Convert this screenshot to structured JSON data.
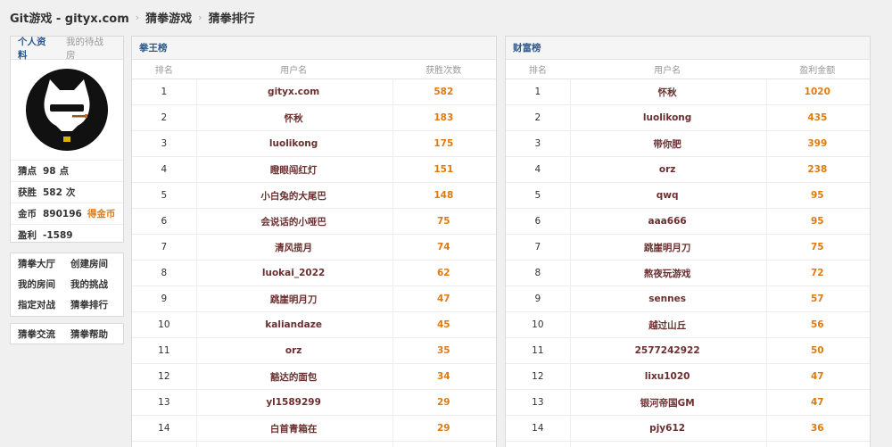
{
  "breadcrumb": [
    "Git游戏 - gityx.com",
    "猜拳游戏",
    "猜拳排行"
  ],
  "profile": {
    "tab_active": "个人资料",
    "tab_inactive": "我的待战房",
    "stats": [
      {
        "key": "猜点",
        "value": "98",
        "unit": "点"
      },
      {
        "key": "获胜",
        "value": "582",
        "unit": "次"
      },
      {
        "key": "金币",
        "value": "890196",
        "extra": "得金币"
      },
      {
        "key": "盈利",
        "value": "-1589"
      }
    ]
  },
  "menu1": [
    [
      "猜拳大厅",
      "创建房间"
    ],
    [
      "我的房间",
      "我的挑战"
    ],
    [
      "指定对战",
      "猜拳排行"
    ]
  ],
  "menu2": [
    "猜拳交流",
    "猜拳帮助"
  ],
  "left_board": {
    "title": "拳王榜",
    "headers": [
      "排名",
      "用户名",
      "获胜次数"
    ],
    "rows": [
      [
        "1",
        "gityx.com",
        "582"
      ],
      [
        "2",
        "怀秋",
        "183"
      ],
      [
        "3",
        "luolikong",
        "175"
      ],
      [
        "4",
        "瞪眼闯红灯",
        "151"
      ],
      [
        "5",
        "小白兔的大尾巴",
        "148"
      ],
      [
        "6",
        "会说话的小哑巴",
        "75"
      ],
      [
        "7",
        "清风揽月",
        "74"
      ],
      [
        "8",
        "luokai_2022",
        "62"
      ],
      [
        "9",
        "跳崖明月刀",
        "47"
      ],
      [
        "10",
        "kaliandaze",
        "45"
      ],
      [
        "11",
        "orz",
        "35"
      ],
      [
        "12",
        "豁达的面包",
        "34"
      ],
      [
        "13",
        "yl1589299",
        "29"
      ],
      [
        "14",
        "白首青箱在",
        "29"
      ]
    ]
  },
  "right_board": {
    "title": "财富榜",
    "headers": [
      "排名",
      "用户名",
      "盈利金额"
    ],
    "rows": [
      [
        "1",
        "怀秋",
        "1020"
      ],
      [
        "2",
        "luolikong",
        "435"
      ],
      [
        "3",
        "带你肥",
        "399"
      ],
      [
        "4",
        "orz",
        "238"
      ],
      [
        "5",
        "qwq",
        "95"
      ],
      [
        "6",
        "aaa666",
        "95"
      ],
      [
        "7",
        "跳崖明月刀",
        "75"
      ],
      [
        "8",
        "熬夜玩游戏",
        "72"
      ],
      [
        "9",
        "sennes",
        "57"
      ],
      [
        "10",
        "越过山丘",
        "56"
      ],
      [
        "11",
        "2577242922",
        "50"
      ],
      [
        "12",
        "lixu1020",
        "47"
      ],
      [
        "13",
        "银河帝国GM",
        "47"
      ],
      [
        "14",
        "pjy612",
        "36"
      ]
    ]
  }
}
